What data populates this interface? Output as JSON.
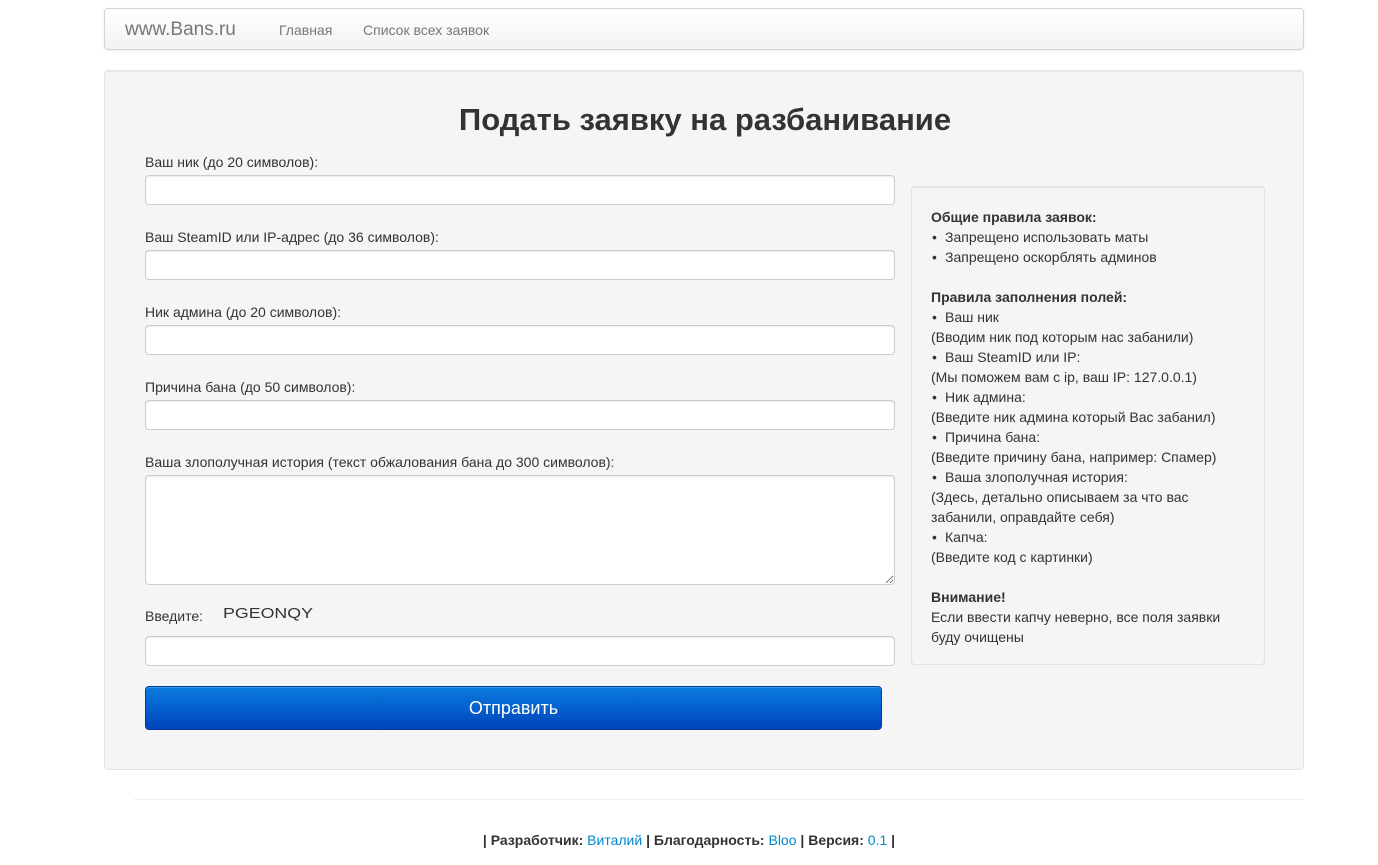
{
  "navbar": {
    "brand": "www.Bans.ru",
    "links": [
      {
        "label": "Главная"
      },
      {
        "label": "Список всех заявок"
      }
    ]
  },
  "form": {
    "title": "Подать заявку на разбанивание",
    "fields": [
      {
        "label": "Ваш ник (до 20 символов):",
        "value": ""
      },
      {
        "label": "Ваш SteamID или IP-адрес (до 36 символов):",
        "value": ""
      },
      {
        "label": "Ник админа (до 20 символов):",
        "value": ""
      },
      {
        "label": "Причина бана (до 50 символов):",
        "value": ""
      },
      {
        "label": "Ваша злополучная история (текст обжалования бана до 300 символов):",
        "value": ""
      }
    ],
    "captcha": {
      "label": "Введите:",
      "image_text": "PGEONQY",
      "value": ""
    },
    "submit_label": "Отправить"
  },
  "rules": {
    "general_title": "Общие правила заявок:",
    "general_items": [
      "Запрещено использовать маты",
      "Запрещено оскорблять админов"
    ],
    "fields_title": "Правила заполнения полей:",
    "field_rules": [
      {
        "name": "Ваш ник",
        "hint": "(Вводим ник под которым нас забанили)"
      },
      {
        "name": "Ваш SteamID или IP:",
        "hint": "(Мы поможем вам с ip, ваш IP: 127.0.0.1)"
      },
      {
        "name": "Ник админа:",
        "hint": "(Введите ник админа который Вас забанил)"
      },
      {
        "name": "Причина бана:",
        "hint": "(Введите причину бана, например: Спамер)"
      },
      {
        "name": "Ваша злополучная история:",
        "hint": "(Здесь, детально описываем за что вас забанили, оправдайте себя)"
      },
      {
        "name": "Капча:",
        "hint": "(Введите код с картинки)"
      }
    ],
    "warning_title": "Внимание!",
    "warning_text": "Если ввести капчу неверно, все поля заявки буду очищены"
  },
  "footer": {
    "developer_label": "Разработчик:",
    "developer_name": "Виталий",
    "thanks_label": "Благодарность:",
    "thanks_name": "Bloo",
    "version_label": "Версия:",
    "version_value": "0.1"
  },
  "colors": {
    "link": "#0088cc",
    "button_top": "#0b7ce0",
    "button_bottom": "#0044bb"
  }
}
